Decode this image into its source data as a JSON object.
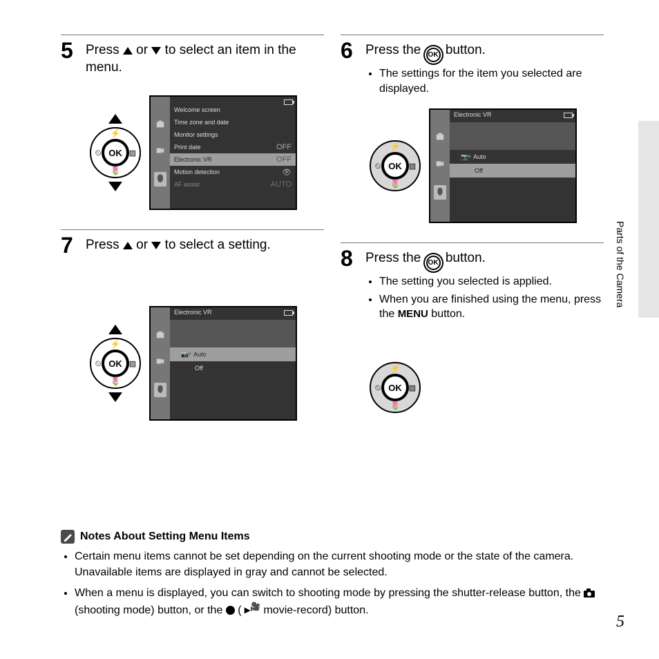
{
  "side_label": "Parts of the Camera",
  "page_number": "5",
  "steps": {
    "s5": {
      "num": "5",
      "text_a": "Press ",
      "text_b": " or ",
      "text_c": " to select an item in the menu.",
      "screen": {
        "rows": [
          {
            "label": "Welcome screen",
            "val": ""
          },
          {
            "label": "Time zone and date",
            "val": ""
          },
          {
            "label": "Monitor settings",
            "val": ""
          },
          {
            "label": "Print date",
            "val": "OFF"
          },
          {
            "label": "Electronic VR",
            "val": "OFF",
            "hl": true
          },
          {
            "label": "Motion detection",
            "val": "👁"
          },
          {
            "label": "AF assist",
            "val": "AUTO"
          }
        ]
      }
    },
    "s6": {
      "num": "6",
      "text_a": "Press the ",
      "text_b": " button.",
      "bullet1": "The settings for the item you selected are displayed.",
      "screen": {
        "title": "Electronic VR",
        "opt1": "Auto",
        "opt2": "Off"
      }
    },
    "s7": {
      "num": "7",
      "text_a": "Press ",
      "text_b": " or ",
      "text_c": " to select a setting.",
      "screen": {
        "title": "Electronic VR",
        "opt1": "Auto",
        "opt2": "Off"
      }
    },
    "s8": {
      "num": "8",
      "text_a": "Press the ",
      "text_b": " button.",
      "bullet1": "The setting you selected is applied.",
      "bullet2_a": "When you are finished using the menu, press the ",
      "bullet2_b": " button.",
      "menu_label": "MENU"
    }
  },
  "notes": {
    "title": "Notes About Setting Menu Items",
    "n1": "Certain menu items cannot be set depending on the current shooting mode or the state of the camera. Unavailable items are displayed in gray and cannot be selected.",
    "n2_a": "When a menu is displayed, you can switch to shooting mode by pressing the shutter-release button, the ",
    "n2_b": " (shooting mode) button, or the ",
    "n2_c": " movie-record) button.",
    "n2_paren": " ("
  }
}
